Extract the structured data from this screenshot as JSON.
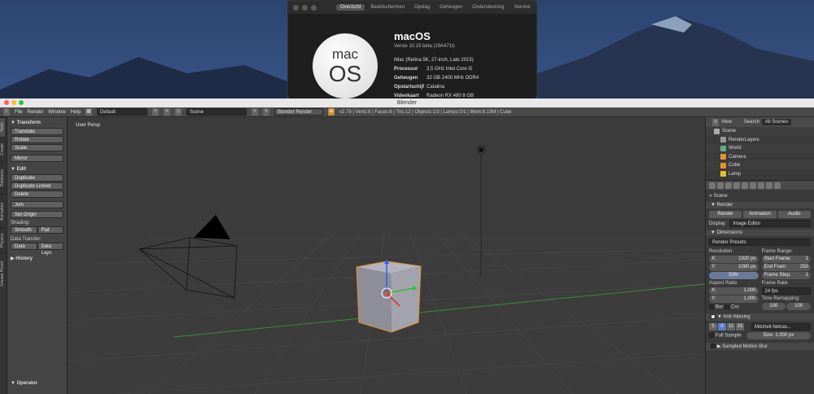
{
  "about": {
    "tabs": [
      "Overzicht",
      "Beeldschermen",
      "Opslag",
      "Geheugen",
      "Ondersteuning",
      "Service"
    ],
    "logo_line1": "mac",
    "logo_line2": "OS",
    "title": "macOS",
    "version": "Versie 10.15 bèta (19A471t)",
    "model": "iMac (Retina 5K, 27-inch, Late 2015)",
    "rows": [
      {
        "k": "Processor",
        "v": "3,5 GHz Intel Core i5"
      },
      {
        "k": "Geheugen",
        "v": "32 GB 2400 MHz DDR4"
      },
      {
        "k": "Opstartschijf",
        "v": "Catalina"
      },
      {
        "k": "Videokaart",
        "v": "Radeon RX 480 8 GB"
      }
    ]
  },
  "blender": {
    "title": "Blender",
    "menu": [
      "File",
      "Render",
      "Window",
      "Help"
    ],
    "layout": "Default",
    "scene": "Scene",
    "engine": "Blender Render",
    "stats": "v2.79 | Verts:8 | Faces:6 | Tris:12 | Objects:1/3 | Lamps:0/1 | Mem:8.13M | Cube",
    "left_tabs": [
      "Tools",
      "Create",
      "Relations",
      "Animation",
      "Physics",
      "Grease Pencil"
    ],
    "toolshelf": {
      "transform_header": "▼ Transform",
      "translate": "Translate",
      "rotate": "Rotate",
      "scale": "Scale",
      "mirror": "Mirror",
      "edit_header": "▼ Edit",
      "duplicate": "Duplicate",
      "duplicate_linked": "Duplicate Linked",
      "delete": "Delete",
      "join": "Join",
      "set_origin": "Set Origin",
      "shading_label": "Shading:",
      "smooth": "Smooth",
      "flat": "Flat",
      "data_transfer_label": "Data Transfer:",
      "data": "Data",
      "data_layo": "Data Layo",
      "history_header": "▶ History",
      "operator_header": "▼ Operator"
    },
    "viewport_label": "User Persp",
    "outliner": {
      "view": "View",
      "search": "Search",
      "all_scenes": "All Scenes",
      "items": [
        "Scene",
        "RenderLayers",
        "World",
        "Camera",
        "Cube",
        "Lamp"
      ]
    },
    "props": {
      "scene_label": "Scene",
      "render_header": "▼ Render",
      "render_btn": "Render",
      "animation_btn": "Animation",
      "audio_btn": "Audio",
      "display_label": "Display:",
      "display_value": "Image Editor",
      "dimensions_header": "▼ Dimensions",
      "render_presets": "Render Presets",
      "resolution_label": "Resolution:",
      "res_x": {
        "k": "X:",
        "v": "1920 px"
      },
      "res_y": {
        "k": "Y:",
        "v": "1080 px"
      },
      "res_pct": "50%",
      "frame_range_label": "Frame Range:",
      "start": {
        "k": "Start Frame:",
        "v": "1"
      },
      "end": {
        "k": "End Fram:",
        "v": "250"
      },
      "step": {
        "k": "Frame Step:",
        "v": "1"
      },
      "aspect_label": "Aspect Ratio:",
      "asp_x": {
        "k": "X:",
        "v": "1.000"
      },
      "asp_y": {
        "k": "Y:",
        "v": "1.000"
      },
      "frame_rate_label": "Frame Rate:",
      "fps": "24 fps",
      "time_remap_label": "Time Remapping:",
      "remap_a": "100",
      "remap_b": "100",
      "bor": "Bor",
      "cro": "Cro",
      "aa_header": "▼ Anti-Aliasing",
      "aa_samples": [
        "5",
        "8",
        "11",
        "16"
      ],
      "aa_filter": "Mitchell-Netrav...",
      "full_sample": "Full Sample",
      "size": "Size: 1.000 px",
      "motion_blur_header": "▶ Sampled Motion Blur"
    }
  }
}
